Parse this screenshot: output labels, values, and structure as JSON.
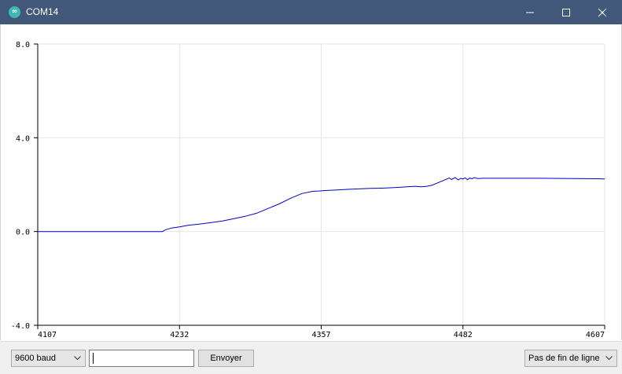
{
  "window": {
    "title": "COM14",
    "app_icon_glyph": "∞"
  },
  "toolbar": {
    "baud_rate": "9600 baud",
    "message_value": "",
    "send_label": "Envoyer",
    "line_ending": "Pas de fin de ligne"
  },
  "colors": {
    "titlebar": "#42587a",
    "series": "#0000cc",
    "grid": "#e6e6e6"
  },
  "chart_data": {
    "type": "line",
    "title": "",
    "xlabel": "",
    "ylabel": "",
    "xlim": [
      4107,
      4607
    ],
    "ylim": [
      -4.0,
      8.0
    ],
    "x_ticks": [
      "4107",
      "4232",
      "4357",
      "4482",
      "4607"
    ],
    "y_ticks": [
      "-4.0",
      "0.0",
      "4.0",
      "8.0"
    ],
    "grid": true,
    "series": [
      {
        "name": "",
        "x": [
          4107,
          4217,
          4218,
          4220,
          4225,
          4232,
          4240,
          4250,
          4260,
          4270,
          4280,
          4290,
          4300,
          4310,
          4320,
          4330,
          4340,
          4350,
          4355,
          4360,
          4370,
          4380,
          4390,
          4400,
          4410,
          4420,
          4430,
          4440,
          4445,
          4450,
          4455,
          4460,
          4465,
          4470,
          4472,
          4475,
          4478,
          4480,
          4482,
          4484,
          4486,
          4488,
          4490,
          4492,
          4495,
          4500,
          4520,
          4550,
          4580,
          4600,
          4607
        ],
        "values": [
          0.0,
          0.0,
          0.03,
          0.08,
          0.15,
          0.2,
          0.27,
          0.32,
          0.38,
          0.45,
          0.55,
          0.65,
          0.78,
          0.98,
          1.18,
          1.42,
          1.62,
          1.72,
          1.73,
          1.75,
          1.77,
          1.8,
          1.82,
          1.84,
          1.85,
          1.87,
          1.9,
          1.93,
          1.91,
          1.93,
          1.98,
          2.08,
          2.18,
          2.28,
          2.22,
          2.3,
          2.2,
          2.27,
          2.24,
          2.29,
          2.21,
          2.28,
          2.25,
          2.3,
          2.26,
          2.27,
          2.27,
          2.27,
          2.26,
          2.25,
          2.24
        ]
      }
    ]
  }
}
